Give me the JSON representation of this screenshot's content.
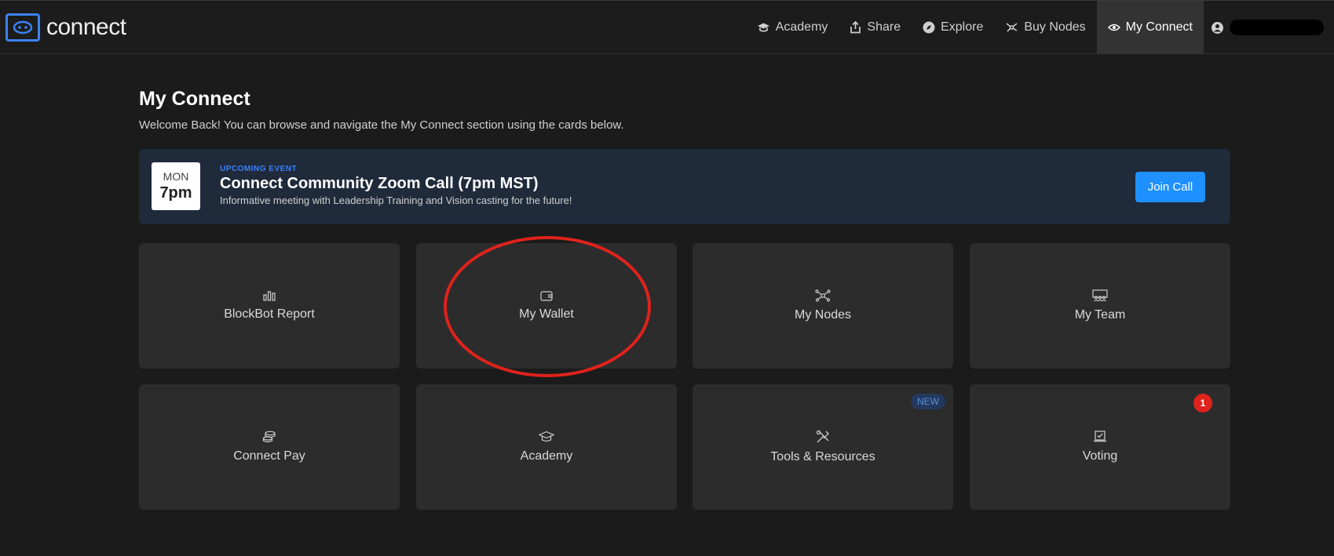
{
  "header": {
    "logo_text": "connect",
    "nav": [
      {
        "label": "Academy",
        "icon": "graduation-cap-icon"
      },
      {
        "label": "Share",
        "icon": "share-icon"
      },
      {
        "label": "Explore",
        "icon": "compass-icon"
      },
      {
        "label": "Buy Nodes",
        "icon": "nodes-icon"
      },
      {
        "label": "My Connect",
        "icon": "eye-icon",
        "active": true
      }
    ],
    "user_icon": "user-icon"
  },
  "page": {
    "title": "My Connect",
    "subtitle": "Welcome Back! You can browse and navigate the My Connect section using the cards below."
  },
  "event": {
    "day": "MON",
    "time": "7pm",
    "tag": "UPCOMING EVENT",
    "title": "Connect Community Zoom Call (7pm MST)",
    "description": "Informative meeting with Leadership Training and Vision casting for the future!",
    "button": "Join Call"
  },
  "cards": [
    {
      "label": "BlockBot Report",
      "icon": "bar-chart-icon"
    },
    {
      "label": "My Wallet",
      "icon": "wallet-icon"
    },
    {
      "label": "My Nodes",
      "icon": "nodes-icon"
    },
    {
      "label": "My Team",
      "icon": "team-icon"
    },
    {
      "label": "Connect Pay",
      "icon": "coins-icon"
    },
    {
      "label": "Academy",
      "icon": "graduation-cap-icon"
    },
    {
      "label": "Tools & Resources",
      "icon": "tools-icon",
      "badge": "NEW"
    },
    {
      "label": "Voting",
      "icon": "ballot-icon",
      "badge": "1"
    }
  ],
  "colors": {
    "accent": "#1e90ff",
    "brand_blue": "#3b82f6",
    "annotation_red": "#e0221c"
  }
}
